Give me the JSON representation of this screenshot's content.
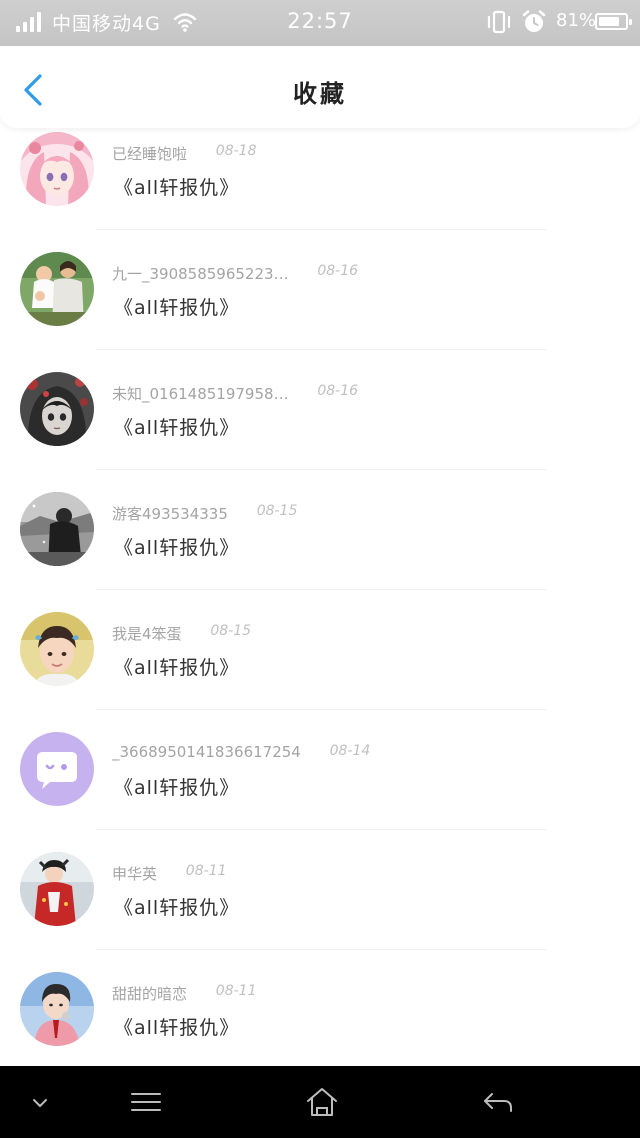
{
  "status_bar": {
    "carrier": "中国移动4G",
    "time": "22:57",
    "battery_percent_label": "81%",
    "battery_level": 0.81,
    "icons": [
      "signal-icon",
      "wifi-icon",
      "vibrate-icon",
      "alarm-icon",
      "battery-icon"
    ]
  },
  "header": {
    "title": "收藏",
    "back_icon": "chevron-left-icon",
    "accent_color": "#2f9bea"
  },
  "items": [
    {
      "name": "已经睡饱啦",
      "date": "08-18",
      "message": "《all轩报仇》"
    },
    {
      "name": "九一_3908585965223…",
      "date": "08-16",
      "message": "《all轩报仇》"
    },
    {
      "name": "未知_0161485197958…",
      "date": "08-16",
      "message": "《all轩报仇》"
    },
    {
      "name": "游客493534335",
      "date": "08-15",
      "message": "《all轩报仇》"
    },
    {
      "name": "我是4笨蛋",
      "date": "08-15",
      "message": "《all轩报仇》"
    },
    {
      "name": "_3668950141836617254",
      "date": "08-14",
      "message": "《all轩报仇》"
    },
    {
      "name": "申华英",
      "date": "08-11",
      "message": "《all轩报仇》"
    },
    {
      "name": "甜甜的暗恋",
      "date": "08-11",
      "message": "《all轩报仇》"
    }
  ],
  "nav": {
    "icons": [
      "chevron-down-icon",
      "menu-icon",
      "home-icon",
      "back-arrow-icon"
    ]
  }
}
